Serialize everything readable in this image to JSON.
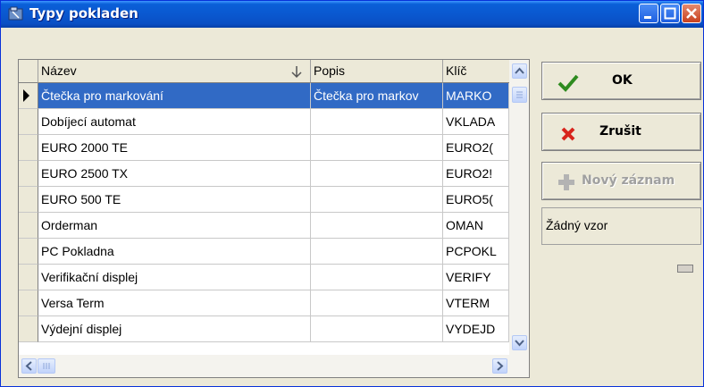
{
  "window": {
    "title": "Typy pokladen"
  },
  "grid": {
    "columns": [
      "Název",
      "Popis",
      "Klíč"
    ],
    "rows": [
      {
        "nazev": "Čtečka pro markování",
        "popis": "Čtečka pro markov",
        "klic": "MARKO",
        "selected": true
      },
      {
        "nazev": "Dobíjecí automat",
        "popis": "",
        "klic": "VKLADA"
      },
      {
        "nazev": "EURO 2000 TE",
        "popis": "",
        "klic": "EURO2("
      },
      {
        "nazev": "EURO 2500 TX",
        "popis": "",
        "klic": "EURO2!"
      },
      {
        "nazev": "EURO 500 TE",
        "popis": "",
        "klic": "EURO5("
      },
      {
        "nazev": "Orderman",
        "popis": "",
        "klic": "OMAN"
      },
      {
        "nazev": "PC Pokladna",
        "popis": "",
        "klic": "PCPOKL"
      },
      {
        "nazev": "Verifikační displej",
        "popis": "",
        "klic": "VERIFY"
      },
      {
        "nazev": "Versa Term",
        "popis": "",
        "klic": "VTERM"
      },
      {
        "nazev": "Výdejní displej",
        "popis": "",
        "klic": "VYDEJD"
      }
    ]
  },
  "buttons": {
    "ok": "OK",
    "cancel": "Zrušit",
    "new_record": "Nový záznam"
  },
  "vzor": {
    "label": "Žádný vzor"
  },
  "colors": {
    "titlebar": "#0a58d0",
    "selection": "#316ac5",
    "dialog_bg": "#ece9d8"
  }
}
